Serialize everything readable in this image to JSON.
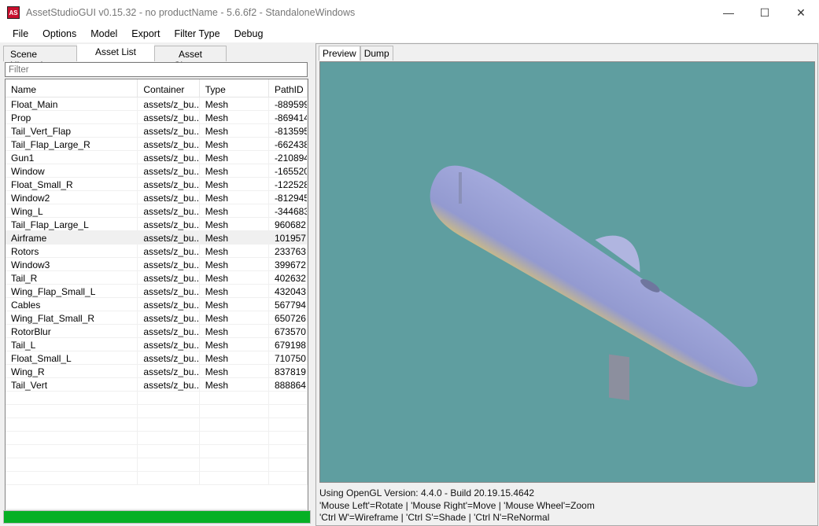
{
  "window": {
    "title": "AssetStudioGUI v0.15.32 - no productName - 5.6.6f2 - StandaloneWindows",
    "icon": "AS",
    "minimize": "—",
    "maximize": "☐",
    "close": "✕"
  },
  "menu": [
    "File",
    "Options",
    "Model",
    "Export",
    "Filter Type",
    "Debug"
  ],
  "left_tabs": [
    "Scene Hierarchy",
    "Asset List",
    "Asset Classes"
  ],
  "filter_placeholder": "Filter",
  "columns": [
    "Name",
    "Container",
    "Type",
    "PathID"
  ],
  "rows": [
    [
      "Float_Main",
      "assets/z_bu...",
      "Mesh",
      "-889599"
    ],
    [
      "Prop",
      "assets/z_bu...",
      "Mesh",
      "-869414"
    ],
    [
      "Tail_Vert_Flap",
      "assets/z_bu...",
      "Mesh",
      "-813595"
    ],
    [
      "Tail_Flap_Large_R",
      "assets/z_bu...",
      "Mesh",
      "-662438"
    ],
    [
      "Gun1",
      "assets/z_bu...",
      "Mesh",
      "-210894"
    ],
    [
      "Window",
      "assets/z_bu...",
      "Mesh",
      "-165520"
    ],
    [
      "Float_Small_R",
      "assets/z_bu...",
      "Mesh",
      "-122528"
    ],
    [
      "Window2",
      "assets/z_bu...",
      "Mesh",
      "-812945"
    ],
    [
      "Wing_L",
      "assets/z_bu...",
      "Mesh",
      "-344683"
    ],
    [
      "Tail_Flap_Large_L",
      "assets/z_bu...",
      "Mesh",
      "960682"
    ],
    [
      "Airframe",
      "assets/z_bu...",
      "Mesh",
      "101957"
    ],
    [
      "Rotors",
      "assets/z_bu...",
      "Mesh",
      "233763"
    ],
    [
      "Window3",
      "assets/z_bu...",
      "Mesh",
      "399672"
    ],
    [
      "Tail_R",
      "assets/z_bu...",
      "Mesh",
      "402632"
    ],
    [
      "Wing_Flap_Small_L",
      "assets/z_bu...",
      "Mesh",
      "432043"
    ],
    [
      "Cables",
      "assets/z_bu...",
      "Mesh",
      "567794"
    ],
    [
      "Wing_Flat_Small_R",
      "assets/z_bu...",
      "Mesh",
      "650726"
    ],
    [
      "RotorBlur",
      "assets/z_bu...",
      "Mesh",
      "673570"
    ],
    [
      "Tail_L",
      "assets/z_bu...",
      "Mesh",
      "679198"
    ],
    [
      "Float_Small_L",
      "assets/z_bu...",
      "Mesh",
      "710750"
    ],
    [
      "Wing_R",
      "assets/z_bu...",
      "Mesh",
      "837819"
    ],
    [
      "Tail_Vert",
      "assets/z_bu...",
      "Mesh",
      "888864"
    ]
  ],
  "selected_row": 10,
  "progress_percent": 100,
  "right_tabs": [
    "Preview",
    "Dump"
  ],
  "info_lines": [
    "Using OpenGL Version: 4.4.0 - Build 20.19.15.4642",
    "'Mouse Left'=Rotate | 'Mouse Right'=Move | 'Mouse Wheel'=Zoom",
    "'Ctrl W'=Wireframe | 'Ctrl S'=Shade | 'Ctrl N'=ReNormal"
  ],
  "colors": {
    "viewport": "#5f9ea0",
    "progress": "#06b025",
    "model": "#9aa3d6"
  }
}
